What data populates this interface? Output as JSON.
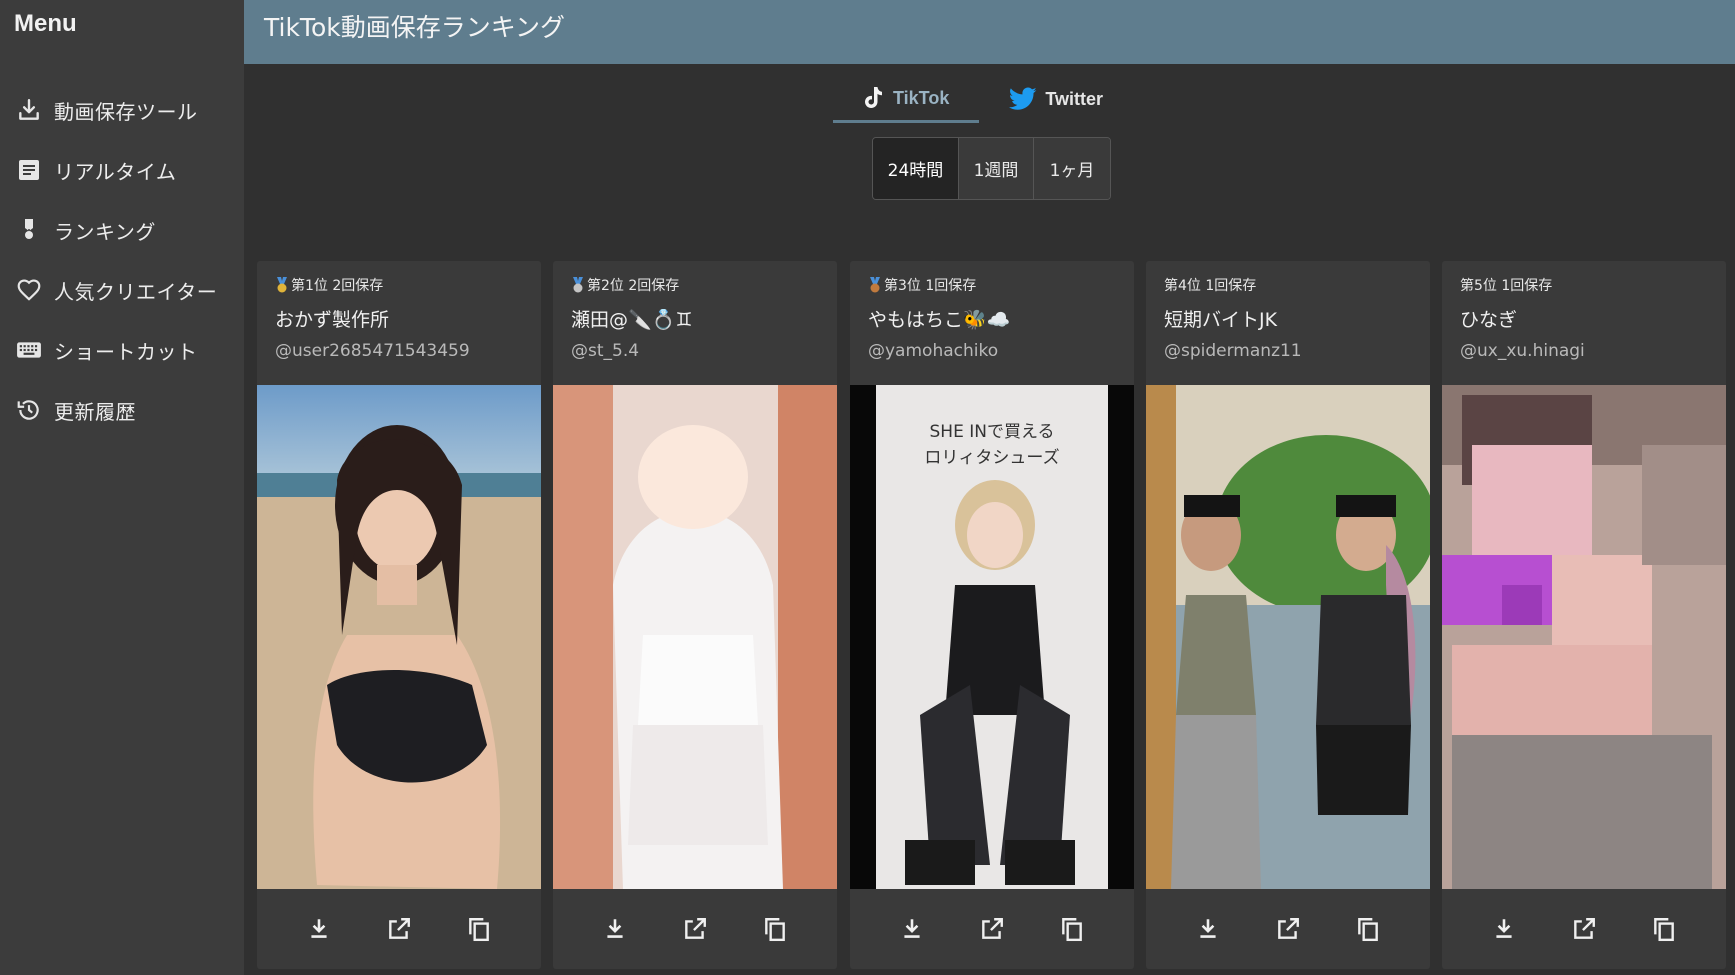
{
  "sidebar": {
    "title": "Menu",
    "items": [
      {
        "label": "動画保存ツール",
        "icon": "download-icon"
      },
      {
        "label": "リアルタイム",
        "icon": "document-icon"
      },
      {
        "label": "ランキング",
        "icon": "medal-icon"
      },
      {
        "label": "人気クリエイター",
        "icon": "heart-icon"
      },
      {
        "label": "ショートカット",
        "icon": "keyboard-icon"
      },
      {
        "label": "更新履歴",
        "icon": "history-icon"
      }
    ]
  },
  "header": {
    "title": "TikTok動画保存ランキング"
  },
  "platform_tabs": [
    {
      "label": "TikTok",
      "icon": "tiktok-icon",
      "active": true
    },
    {
      "label": "Twitter",
      "icon": "twitter-icon",
      "active": false
    }
  ],
  "periods": [
    {
      "label": "24時間",
      "active": true
    },
    {
      "label": "1週間",
      "active": false
    },
    {
      "label": "1ヶ月",
      "active": false
    }
  ],
  "cards": [
    {
      "rank": "第1位 2回保存",
      "name": "おかず製作所",
      "handle": "@user2685471543459",
      "medal": "gold-medal-icon"
    },
    {
      "rank": "第2位 2回保存",
      "name": "瀬田@🔪💍♊︎",
      "handle": "@st_5.4",
      "medal": "silver-medal-icon"
    },
    {
      "rank": "第3位 1回保存",
      "name": "やもはちこ🐝☁️",
      "handle": "@yamohachiko",
      "medal": "bronze-medal-icon"
    },
    {
      "rank": "第4位 1回保存",
      "name": "短期バイトJK",
      "handle": "@spidermanz11",
      "medal": ""
    },
    {
      "rank": "第5位 1回保存",
      "name": "ひなぎ",
      "handle": "@ux_xu.hinagi",
      "medal": ""
    }
  ],
  "thumbnail_texts": {
    "card3": [
      "SHE INで買える",
      "ロリィタシューズ"
    ]
  },
  "colors": {
    "header": "#5f7d8e",
    "sidebar": "#3c3c3c",
    "background": "#303030",
    "card": "#3a3a3a",
    "accent_tab": "#9ab3c3"
  }
}
